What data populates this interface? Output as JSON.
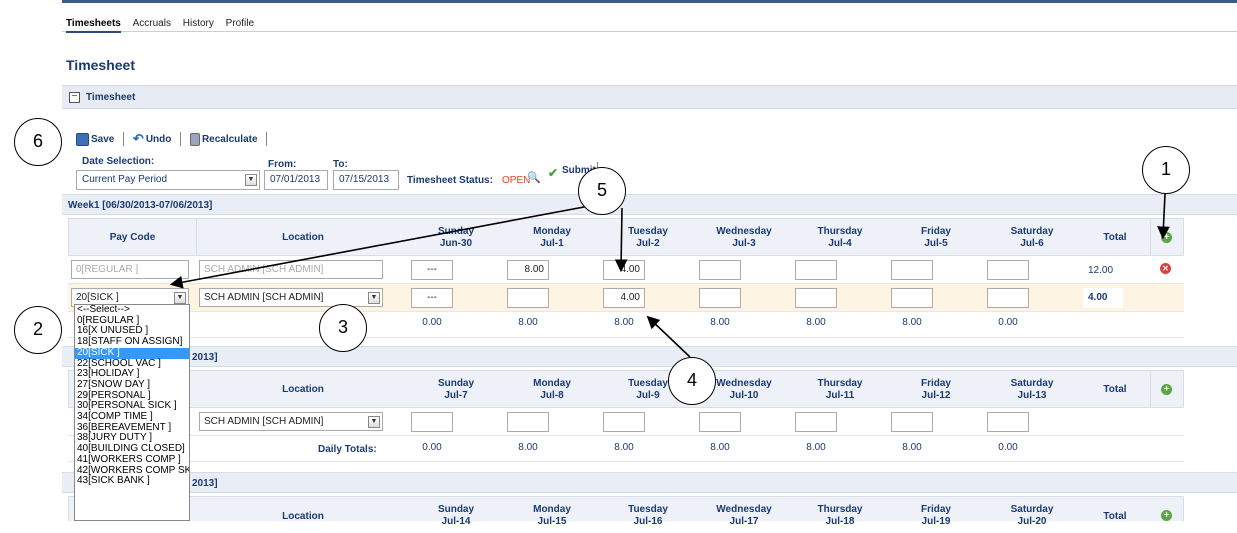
{
  "nav": {
    "tabs": [
      "Timesheets",
      "Accruals",
      "History",
      "Profile"
    ]
  },
  "page_title": "Timesheet",
  "panel_title": "Timesheet",
  "panel_toggle": "−",
  "toolbar": {
    "save": "Save",
    "undo": "Undo",
    "recalculate": "Recalculate"
  },
  "filters": {
    "date_selection_label": "Date Selection:",
    "date_selection_value": "Current Pay Period",
    "from_label": "From:",
    "from_value": "07/01/2013",
    "to_label": "To:",
    "to_value": "07/15/2013",
    "status_label": "Timesheet Status:",
    "status_value": "OPEN",
    "submit_label": "Submit"
  },
  "columns": {
    "pay_code": "Pay Code",
    "location": "Location",
    "total": "Total"
  },
  "week1": {
    "title": "Week1 [06/30/2013-07/06/2013]",
    "days": [
      [
        "Sunday",
        "Jun-30"
      ],
      [
        "Monday",
        "Jul-1"
      ],
      [
        "Tuesday",
        "Jul-2"
      ],
      [
        "Wednesday",
        "Jul-3"
      ],
      [
        "Thursday",
        "Jul-4"
      ],
      [
        "Friday",
        "Jul-5"
      ],
      [
        "Saturday",
        "Jul-6"
      ]
    ],
    "rows": [
      {
        "pay_code": "0[REGULAR ]",
        "location": "SCH ADMIN [SCH ADMIN]",
        "values": [
          "---",
          "8.00",
          "4.00",
          "",
          "",
          "",
          ""
        ],
        "total": "12.00"
      },
      {
        "pay_code": "20[SICK ]",
        "location": "SCH ADMIN [SCH ADMIN]",
        "values": [
          "---",
          "",
          "4.00",
          "",
          "",
          "",
          ""
        ],
        "total": "4.00"
      }
    ],
    "daily_totals": [
      "0.00",
      "8.00",
      "8.00",
      "8.00",
      "8.00",
      "8.00",
      "0.00"
    ]
  },
  "week2": {
    "title_suffix": "2013]",
    "days": [
      [
        "Sunday",
        "Jul-7"
      ],
      [
        "Monday",
        "Jul-8"
      ],
      [
        "Tuesday",
        "Jul-9"
      ],
      [
        "Wednesday",
        "Jul-10"
      ],
      [
        "Thursday",
        "Jul-11"
      ],
      [
        "Friday",
        "Jul-12"
      ],
      [
        "Saturday",
        "Jul-13"
      ]
    ],
    "location": "SCH ADMIN [SCH ADMIN]",
    "daily_totals_label": "Daily Totals:",
    "daily_totals": [
      "0.00",
      "8.00",
      "8.00",
      "8.00",
      "8.00",
      "8.00",
      "0.00"
    ]
  },
  "week3": {
    "title_suffix": "2013]",
    "days": [
      [
        "Sunday",
        "Jul-14"
      ],
      [
        "Monday",
        "Jul-15"
      ],
      [
        "Tuesday",
        "Jul-16"
      ],
      [
        "Wednesday",
        "Jul-17"
      ],
      [
        "Thursday",
        "Jul-18"
      ],
      [
        "Friday",
        "Jul-19"
      ],
      [
        "Saturday",
        "Jul-20"
      ]
    ]
  },
  "pay_code_options": [
    "<--Select-->",
    "0[REGULAR ]",
    "16[X UNUSED ]",
    "18[STAFF ON ASSIGN]",
    "20[SICK ]",
    "22[SCHOOL VAC ]",
    "23[HOLIDAY ]",
    "27[SNOW DAY ]",
    "29[PERSONAL ]",
    "30[PERSONAL SICK ]",
    "34[COMP TIME ]",
    "36[BEREAVEMENT ]",
    "38[JURY DUTY ]",
    "40[BUILDING CLOSED]",
    "41[WORKERS COMP ]",
    "42[WORKERS COMP SK",
    "43[SICK BANK ]"
  ],
  "pay_code_selected_index": 4,
  "callouts": [
    "1",
    "2",
    "3",
    "4",
    "5",
    "6"
  ],
  "colors": {
    "status_open": "#e8401c",
    "accent": "#1a3a72",
    "highlight": "#3399ff",
    "sick_row": "#fdf5e2"
  }
}
